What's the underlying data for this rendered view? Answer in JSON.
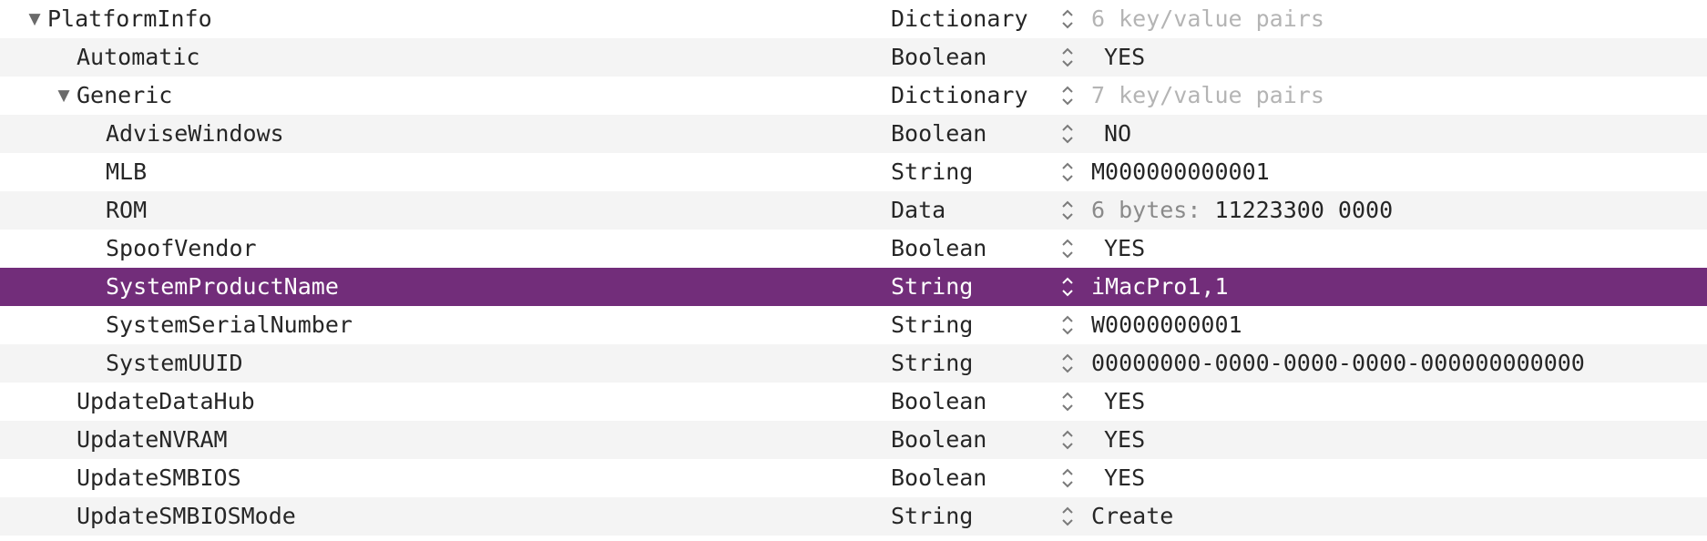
{
  "rows": [
    {
      "key": "PlatformInfo",
      "type": "Dictionary",
      "value": "6 key/value pairs",
      "value_prefix": "",
      "disclosure": "▼",
      "muted": true
    },
    {
      "key": "Automatic",
      "type": "Boolean",
      "value": "YES",
      "value_prefix": "",
      "disclosure": "",
      "muted": false
    },
    {
      "key": "Generic",
      "type": "Dictionary",
      "value": "7 key/value pairs",
      "value_prefix": "",
      "disclosure": "▼",
      "muted": true
    },
    {
      "key": "AdviseWindows",
      "type": "Boolean",
      "value": "NO",
      "value_prefix": "",
      "disclosure": "",
      "muted": false
    },
    {
      "key": "MLB",
      "type": "String",
      "value": "M000000000001",
      "value_prefix": "",
      "disclosure": "",
      "muted": false
    },
    {
      "key": "ROM",
      "type": "Data",
      "value": "11223300 0000",
      "value_prefix": "6 bytes: ",
      "disclosure": "",
      "muted": false
    },
    {
      "key": "SpoofVendor",
      "type": "Boolean",
      "value": "YES",
      "value_prefix": "",
      "disclosure": "",
      "muted": false
    },
    {
      "key": "SystemProductName",
      "type": "String",
      "value": "iMacPro1,1",
      "value_prefix": "",
      "disclosure": "",
      "muted": false
    },
    {
      "key": "SystemSerialNumber",
      "type": "String",
      "value": "W0000000001",
      "value_prefix": "",
      "disclosure": "",
      "muted": false
    },
    {
      "key": "SystemUUID",
      "type": "String",
      "value": "00000000-0000-0000-0000-000000000000",
      "value_prefix": "",
      "disclosure": "",
      "muted": false
    },
    {
      "key": "UpdateDataHub",
      "type": "Boolean",
      "value": "YES",
      "value_prefix": "",
      "disclosure": "",
      "muted": false
    },
    {
      "key": "UpdateNVRAM",
      "type": "Boolean",
      "value": "YES",
      "value_prefix": "",
      "disclosure": "",
      "muted": false
    },
    {
      "key": "UpdateSMBIOS",
      "type": "Boolean",
      "value": "YES",
      "value_prefix": "",
      "disclosure": "",
      "muted": false
    },
    {
      "key": "UpdateSMBIOSMode",
      "type": "String",
      "value": "Create",
      "value_prefix": "",
      "disclosure": "",
      "muted": false
    }
  ],
  "selected_key": "SystemProductName",
  "colors": {
    "selection": "#722d7a",
    "alt_row": "#f4f4f4",
    "muted_value": "#b4b4b4"
  }
}
